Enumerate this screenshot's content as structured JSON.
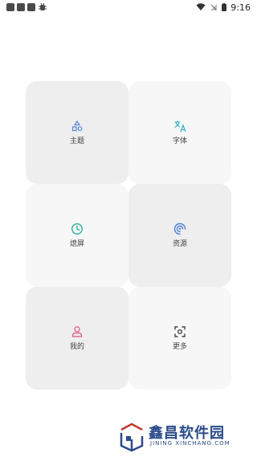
{
  "status_bar": {
    "time": "9:16"
  },
  "tiles": [
    {
      "label": "主题",
      "icon": "shapes-icon",
      "color": "#5b8bd9"
    },
    {
      "label": "字体",
      "icon": "translate-icon",
      "color": "#3fb6c9"
    },
    {
      "label": "熄屏",
      "icon": "clock-icon",
      "color": "#2ab0a0"
    },
    {
      "label": "资源",
      "icon": "swirl-icon",
      "color": "#4a7fd8"
    },
    {
      "label": "我的",
      "icon": "person-icon",
      "color": "#e06b8b"
    },
    {
      "label": "更多",
      "icon": "scan-frame-icon",
      "color": "#444444"
    }
  ],
  "watermark": {
    "title": "鑫昌软件园",
    "subtitle": "JINING XINCHANG.COM",
    "color": "#2a4a8a"
  }
}
